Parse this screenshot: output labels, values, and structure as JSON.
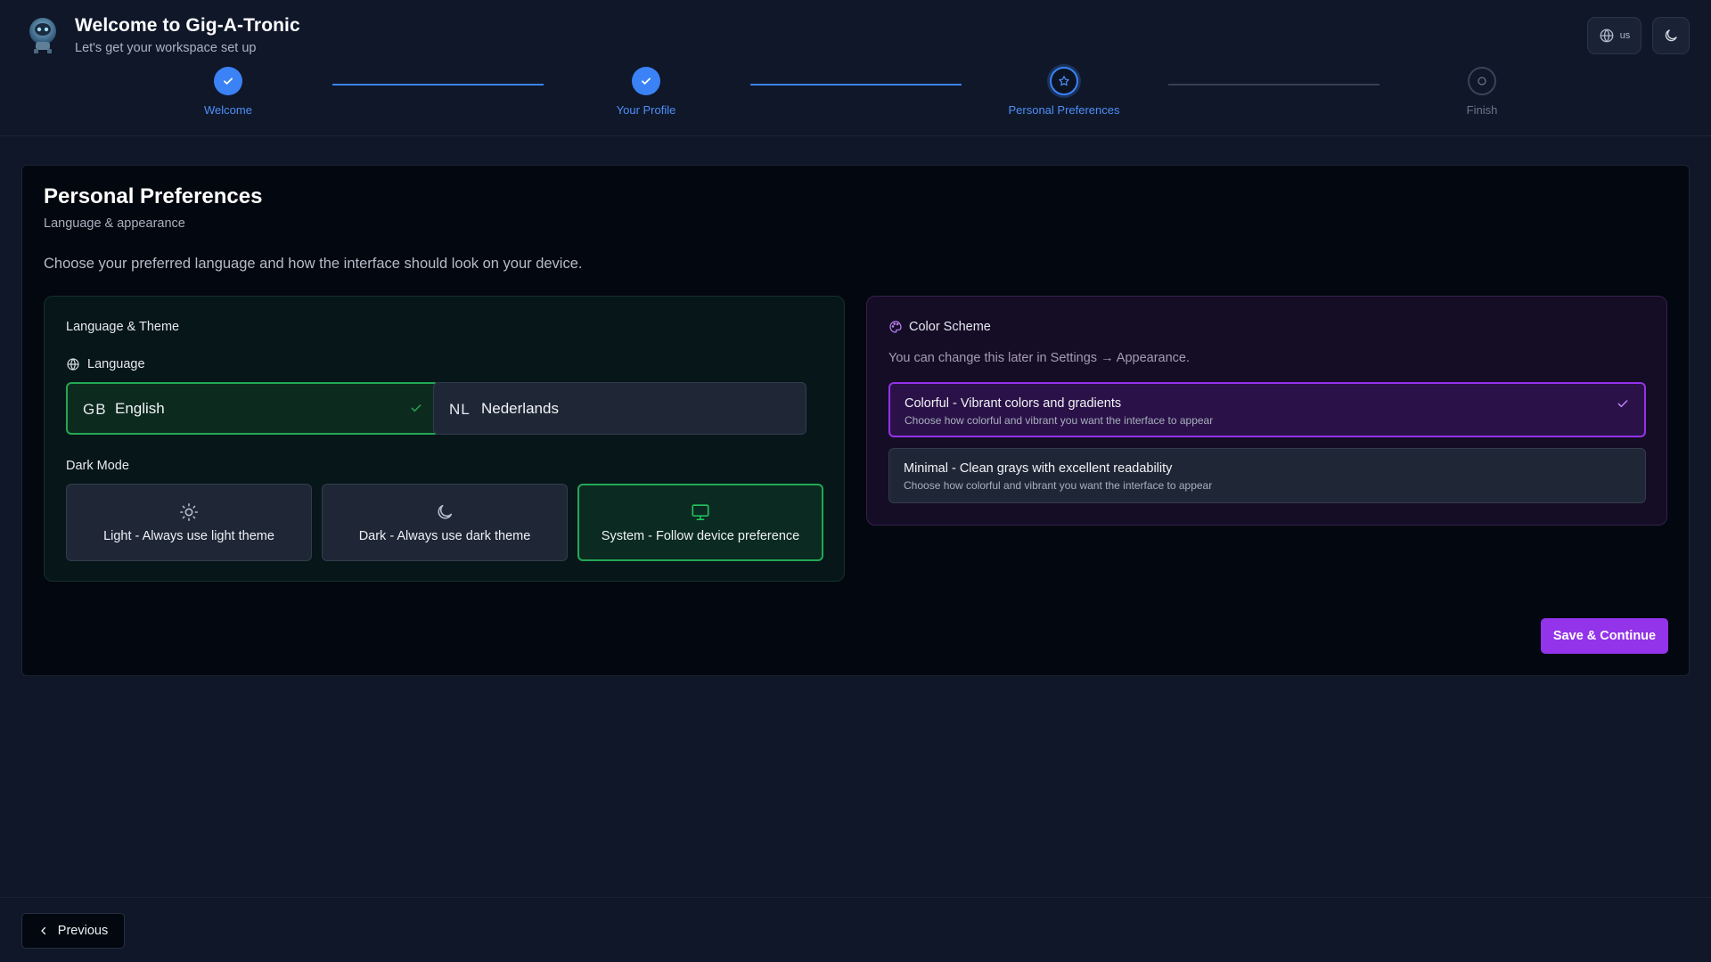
{
  "header": {
    "title": "Welcome to Gig-A-Tronic",
    "subtitle": "Let's get your workspace set up",
    "language_button": "us",
    "icons": {
      "logo": "robot-avatar",
      "language": "globe-icon",
      "theme": "moon-icon"
    }
  },
  "stepper": {
    "steps": [
      {
        "label": "Welcome",
        "status": "done"
      },
      {
        "label": "Your Profile",
        "status": "done"
      },
      {
        "label": "Personal Preferences",
        "status": "active"
      },
      {
        "label": "Finish",
        "status": "pending"
      }
    ]
  },
  "card": {
    "title": "Personal Preferences",
    "subtitle": "Language & appearance",
    "description": "Choose your preferred language and how the interface should look on your device."
  },
  "language_theme": {
    "title": "Language & Theme",
    "language_label": "Language",
    "languages": [
      {
        "code": "GB",
        "name": "English",
        "selected": true
      },
      {
        "code": "NL",
        "name": "Nederlands",
        "selected": false
      }
    ],
    "dark_mode_label": "Dark Mode",
    "dark_mode_options": [
      {
        "label": "Light - Always use light theme",
        "icon": "sun-icon",
        "selected": false
      },
      {
        "label": "Dark - Always use dark theme",
        "icon": "moon-icon",
        "selected": false
      },
      {
        "label": "System - Follow device preference",
        "icon": "monitor-icon",
        "selected": true
      }
    ]
  },
  "color_scheme": {
    "title": "Color Scheme",
    "note": "You can change this later in Settings → Appearance.",
    "options": [
      {
        "title": "Colorful - Vibrant colors and gradients",
        "description": "Choose how colorful and vibrant you want the interface to appear",
        "selected": true
      },
      {
        "title": "Minimal - Clean grays with excellent readability",
        "description": "Choose how colorful and vibrant you want the interface to appear",
        "selected": false
      }
    ]
  },
  "actions": {
    "save_label": "Save & Continue",
    "previous_label": "Previous"
  },
  "colors": {
    "background": "#0f1729",
    "card": "#03070f",
    "accent_blue": "#3b82f6",
    "accent_green": "#22a854",
    "accent_purple": "#9333ea"
  }
}
